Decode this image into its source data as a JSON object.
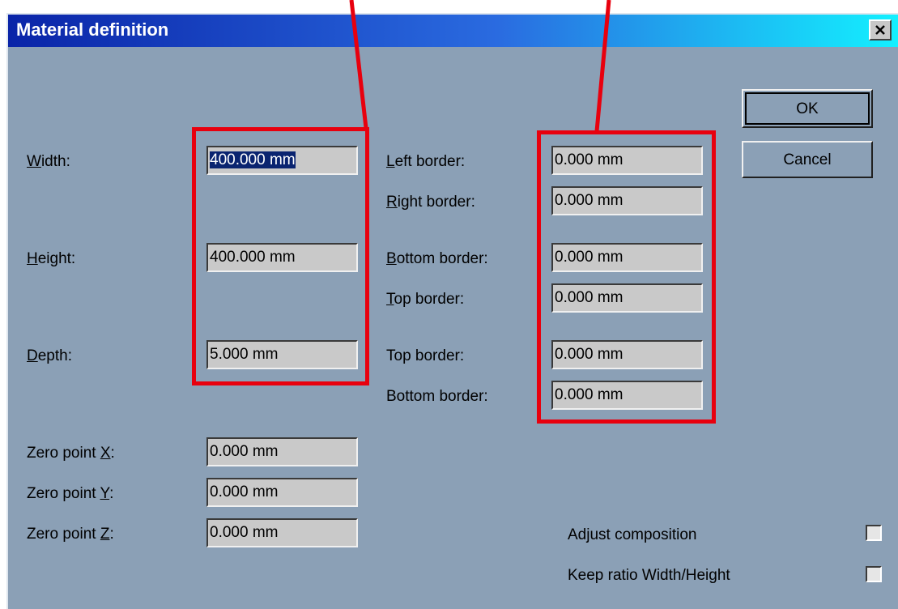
{
  "dialog": {
    "title": "Material definition",
    "close_icon": "close-x-icon"
  },
  "left_fields": {
    "width": {
      "label_u": "W",
      "label_rest": "idth:",
      "value": "400.000 mm"
    },
    "height": {
      "label_u": "H",
      "label_rest": "eight:",
      "value": "400.000 mm"
    },
    "depth": {
      "label_u": "D",
      "label_rest": "epth:",
      "value": "5.000 mm"
    }
  },
  "zero_points": {
    "x": {
      "label_pre": "Zero point ",
      "label_u": "X",
      "label_post": ":",
      "value": "0.000 mm"
    },
    "y": {
      "label_pre": "Zero point ",
      "label_u": "Y",
      "label_post": ":",
      "value": "0.000 mm"
    },
    "z": {
      "label_pre": "Zero point ",
      "label_u": "Z",
      "label_post": ":",
      "value": "0.000 mm"
    }
  },
  "borders": {
    "left": {
      "label_u": "L",
      "label_rest": "eft border:",
      "value": "0.000 mm"
    },
    "right": {
      "label_u": "R",
      "label_rest": "ight border:",
      "value": "0.000 mm"
    },
    "bottom": {
      "label_u": "B",
      "label_rest": "ottom border:",
      "value": "0.000 mm"
    },
    "top": {
      "label_u": "T",
      "label_rest": "op border:",
      "value": "0.000 mm"
    },
    "top_z": {
      "label": "Top border:",
      "value": "0.000 mm"
    },
    "bottom_z": {
      "label": "Bottom border:",
      "value": "0.000 mm"
    }
  },
  "buttons": {
    "ok": "OK",
    "cancel": "Cancel"
  },
  "options": {
    "adjust_composition": {
      "label": "Adjust composition",
      "checked": false
    },
    "keep_ratio": {
      "label": "Keep ratio Width/Height",
      "checked": false
    }
  },
  "annotation": {
    "highlight_color": "#e8000e"
  }
}
